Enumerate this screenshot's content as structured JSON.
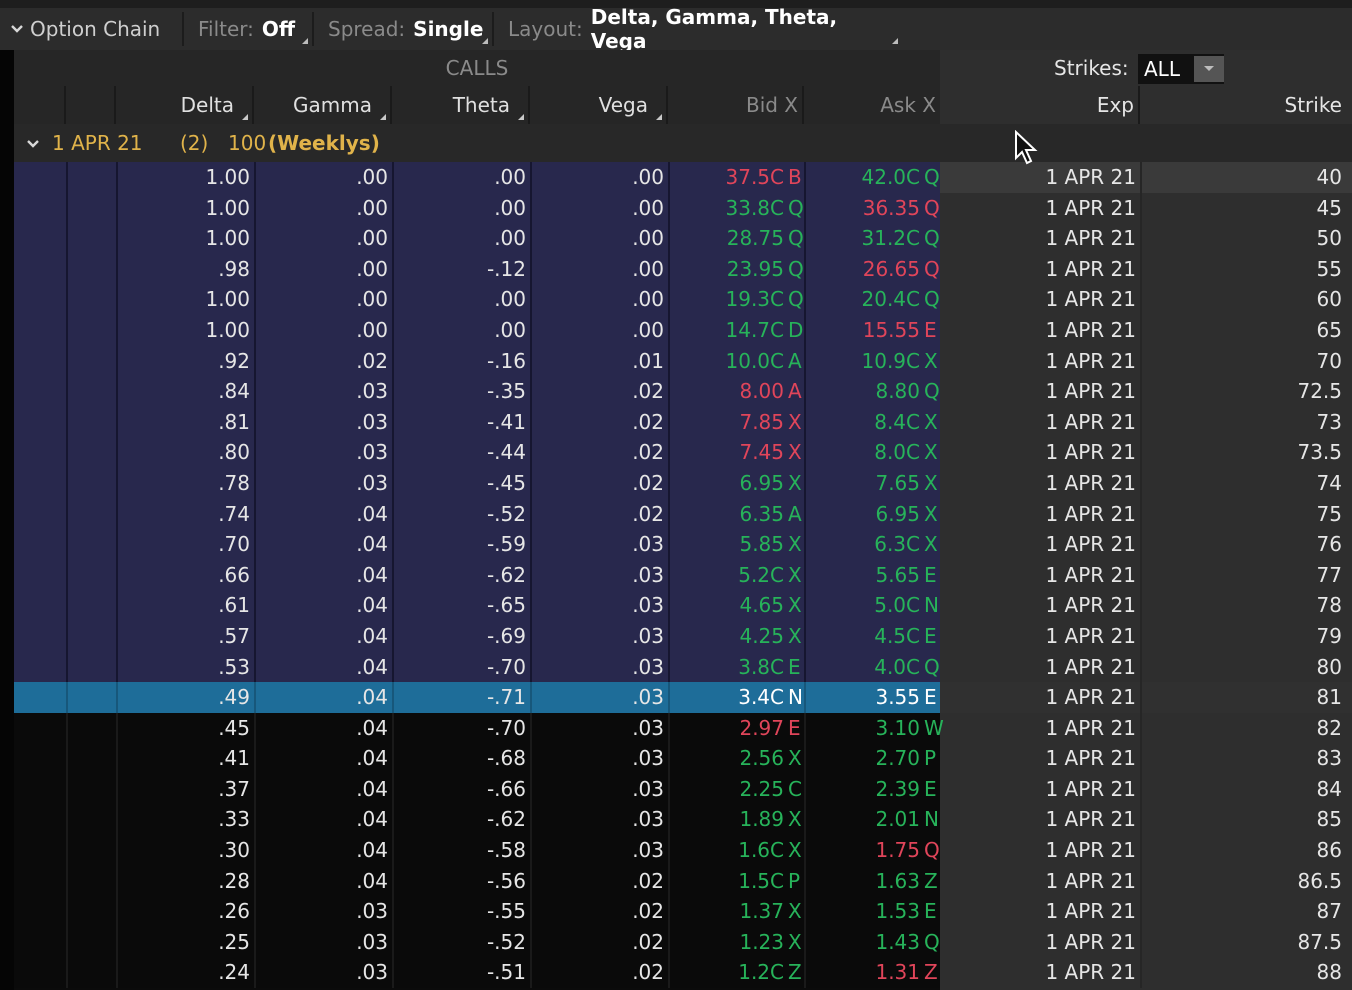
{
  "toolbar": {
    "title": "Option Chain",
    "filter_label": "Filter:",
    "filter_value": "Off",
    "spread_label": "Spread:",
    "spread_value": "Single",
    "layout_label": "Layout:",
    "layout_value": "Delta, Gamma, Theta, Vega"
  },
  "calls_header": "CALLS",
  "strikes": {
    "label": "Strikes:",
    "value": "ALL"
  },
  "columns": {
    "delta": "Delta",
    "gamma": "Gamma",
    "theta": "Theta",
    "vega": "Vega",
    "bid": "Bid X",
    "ask": "Ask X",
    "exp": "Exp",
    "strike": "Strike"
  },
  "group": {
    "label": "1 APR 21",
    "count": "(2)",
    "multiplier": "100",
    "tag": "(Weeklys)"
  },
  "colors": {
    "itm_bg": "#28284d",
    "selected_bg": "#1e6d99",
    "bid_ask_up": "#27b35a",
    "bid_ask_down": "#e0455a",
    "group_text": "#e0b34a"
  },
  "rows": [
    {
      "delta": "1.00",
      "gamma": ".00",
      "theta": ".00",
      "vega": ".00",
      "bid": "37.5C",
      "bid_ex": "B",
      "bid_color": "red",
      "ask": "42.0C",
      "ask_ex": "Q",
      "ask_color": "green",
      "exp": "1 APR 21",
      "strike": "40",
      "state": "itm"
    },
    {
      "delta": "1.00",
      "gamma": ".00",
      "theta": ".00",
      "vega": ".00",
      "bid": "33.8C",
      "bid_ex": "Q",
      "bid_color": "green",
      "ask": "36.35",
      "ask_ex": "Q",
      "ask_color": "red",
      "exp": "1 APR 21",
      "strike": "45",
      "state": "itm"
    },
    {
      "delta": "1.00",
      "gamma": ".00",
      "theta": ".00",
      "vega": ".00",
      "bid": "28.75",
      "bid_ex": "Q",
      "bid_color": "green",
      "ask": "31.2C",
      "ask_ex": "Q",
      "ask_color": "green",
      "exp": "1 APR 21",
      "strike": "50",
      "state": "itm"
    },
    {
      "delta": ".98",
      "gamma": ".00",
      "theta": "-.12",
      "vega": ".00",
      "bid": "23.95",
      "bid_ex": "Q",
      "bid_color": "green",
      "ask": "26.65",
      "ask_ex": "Q",
      "ask_color": "red",
      "exp": "1 APR 21",
      "strike": "55",
      "state": "itm"
    },
    {
      "delta": "1.00",
      "gamma": ".00",
      "theta": ".00",
      "vega": ".00",
      "bid": "19.3C",
      "bid_ex": "Q",
      "bid_color": "green",
      "ask": "20.4C",
      "ask_ex": "Q",
      "ask_color": "green",
      "exp": "1 APR 21",
      "strike": "60",
      "state": "itm"
    },
    {
      "delta": "1.00",
      "gamma": ".00",
      "theta": ".00",
      "vega": ".00",
      "bid": "14.7C",
      "bid_ex": "D",
      "bid_color": "green",
      "ask": "15.55",
      "ask_ex": "E",
      "ask_color": "red",
      "exp": "1 APR 21",
      "strike": "65",
      "state": "itm"
    },
    {
      "delta": ".92",
      "gamma": ".02",
      "theta": "-.16",
      "vega": ".01",
      "bid": "10.0C",
      "bid_ex": "A",
      "bid_color": "green",
      "ask": "10.9C",
      "ask_ex": "X",
      "ask_color": "green",
      "exp": "1 APR 21",
      "strike": "70",
      "state": "itm"
    },
    {
      "delta": ".84",
      "gamma": ".03",
      "theta": "-.35",
      "vega": ".02",
      "bid": "8.00",
      "bid_ex": "A",
      "bid_color": "red",
      "ask": "8.80",
      "ask_ex": "Q",
      "ask_color": "green",
      "exp": "1 APR 21",
      "strike": "72.5",
      "state": "itm"
    },
    {
      "delta": ".81",
      "gamma": ".03",
      "theta": "-.41",
      "vega": ".02",
      "bid": "7.85",
      "bid_ex": "X",
      "bid_color": "red",
      "ask": "8.4C",
      "ask_ex": "X",
      "ask_color": "green",
      "exp": "1 APR 21",
      "strike": "73",
      "state": "itm"
    },
    {
      "delta": ".80",
      "gamma": ".03",
      "theta": "-.44",
      "vega": ".02",
      "bid": "7.45",
      "bid_ex": "X",
      "bid_color": "red",
      "ask": "8.0C",
      "ask_ex": "X",
      "ask_color": "green",
      "exp": "1 APR 21",
      "strike": "73.5",
      "state": "itm"
    },
    {
      "delta": ".78",
      "gamma": ".03",
      "theta": "-.45",
      "vega": ".02",
      "bid": "6.95",
      "bid_ex": "X",
      "bid_color": "green",
      "ask": "7.65",
      "ask_ex": "X",
      "ask_color": "green",
      "exp": "1 APR 21",
      "strike": "74",
      "state": "itm"
    },
    {
      "delta": ".74",
      "gamma": ".04",
      "theta": "-.52",
      "vega": ".02",
      "bid": "6.35",
      "bid_ex": "A",
      "bid_color": "green",
      "ask": "6.95",
      "ask_ex": "X",
      "ask_color": "green",
      "exp": "1 APR 21",
      "strike": "75",
      "state": "itm"
    },
    {
      "delta": ".70",
      "gamma": ".04",
      "theta": "-.59",
      "vega": ".03",
      "bid": "5.85",
      "bid_ex": "X",
      "bid_color": "green",
      "ask": "6.3C",
      "ask_ex": "X",
      "ask_color": "green",
      "exp": "1 APR 21",
      "strike": "76",
      "state": "itm"
    },
    {
      "delta": ".66",
      "gamma": ".04",
      "theta": "-.62",
      "vega": ".03",
      "bid": "5.2C",
      "bid_ex": "X",
      "bid_color": "green",
      "ask": "5.65",
      "ask_ex": "E",
      "ask_color": "green",
      "exp": "1 APR 21",
      "strike": "77",
      "state": "itm"
    },
    {
      "delta": ".61",
      "gamma": ".04",
      "theta": "-.65",
      "vega": ".03",
      "bid": "4.65",
      "bid_ex": "X",
      "bid_color": "green",
      "ask": "5.0C",
      "ask_ex": "N",
      "ask_color": "green",
      "exp": "1 APR 21",
      "strike": "78",
      "state": "itm"
    },
    {
      "delta": ".57",
      "gamma": ".04",
      "theta": "-.69",
      "vega": ".03",
      "bid": "4.25",
      "bid_ex": "X",
      "bid_color": "green",
      "ask": "4.5C",
      "ask_ex": "E",
      "ask_color": "green",
      "exp": "1 APR 21",
      "strike": "79",
      "state": "itm"
    },
    {
      "delta": ".53",
      "gamma": ".04",
      "theta": "-.70",
      "vega": ".03",
      "bid": "3.8C",
      "bid_ex": "E",
      "bid_color": "green",
      "ask": "4.0C",
      "ask_ex": "Q",
      "ask_color": "green",
      "exp": "1 APR 21",
      "strike": "80",
      "state": "itm"
    },
    {
      "delta": ".49",
      "gamma": ".04",
      "theta": "-.71",
      "vega": ".03",
      "bid": "3.4C",
      "bid_ex": "N",
      "bid_color": "white",
      "ask": "3.55",
      "ask_ex": "E",
      "ask_color": "white",
      "exp": "1 APR 21",
      "strike": "81",
      "state": "sel"
    },
    {
      "delta": ".45",
      "gamma": ".04",
      "theta": "-.70",
      "vega": ".03",
      "bid": "2.97",
      "bid_ex": "E",
      "bid_color": "red",
      "ask": "3.10",
      "ask_ex": "W",
      "ask_color": "green",
      "exp": "1 APR 21",
      "strike": "82",
      "state": "otm"
    },
    {
      "delta": ".41",
      "gamma": ".04",
      "theta": "-.68",
      "vega": ".03",
      "bid": "2.56",
      "bid_ex": "X",
      "bid_color": "green",
      "ask": "2.70",
      "ask_ex": "P",
      "ask_color": "green",
      "exp": "1 APR 21",
      "strike": "83",
      "state": "otm"
    },
    {
      "delta": ".37",
      "gamma": ".04",
      "theta": "-.66",
      "vega": ".03",
      "bid": "2.25",
      "bid_ex": "C",
      "bid_color": "green",
      "ask": "2.39",
      "ask_ex": "E",
      "ask_color": "green",
      "exp": "1 APR 21",
      "strike": "84",
      "state": "otm"
    },
    {
      "delta": ".33",
      "gamma": ".04",
      "theta": "-.62",
      "vega": ".03",
      "bid": "1.89",
      "bid_ex": "X",
      "bid_color": "green",
      "ask": "2.01",
      "ask_ex": "N",
      "ask_color": "green",
      "exp": "1 APR 21",
      "strike": "85",
      "state": "otm"
    },
    {
      "delta": ".30",
      "gamma": ".04",
      "theta": "-.58",
      "vega": ".03",
      "bid": "1.6C",
      "bid_ex": "X",
      "bid_color": "green",
      "ask": "1.75",
      "ask_ex": "Q",
      "ask_color": "red",
      "exp": "1 APR 21",
      "strike": "86",
      "state": "otm"
    },
    {
      "delta": ".28",
      "gamma": ".04",
      "theta": "-.56",
      "vega": ".02",
      "bid": "1.5C",
      "bid_ex": "P",
      "bid_color": "green",
      "ask": "1.63",
      "ask_ex": "Z",
      "ask_color": "green",
      "exp": "1 APR 21",
      "strike": "86.5",
      "state": "otm"
    },
    {
      "delta": ".26",
      "gamma": ".03",
      "theta": "-.55",
      "vega": ".02",
      "bid": "1.37",
      "bid_ex": "X",
      "bid_color": "green",
      "ask": "1.53",
      "ask_ex": "E",
      "ask_color": "green",
      "exp": "1 APR 21",
      "strike": "87",
      "state": "otm"
    },
    {
      "delta": ".25",
      "gamma": ".03",
      "theta": "-.52",
      "vega": ".02",
      "bid": "1.23",
      "bid_ex": "X",
      "bid_color": "green",
      "ask": "1.43",
      "ask_ex": "Q",
      "ask_color": "green",
      "exp": "1 APR 21",
      "strike": "87.5",
      "state": "otm"
    },
    {
      "delta": ".24",
      "gamma": ".03",
      "theta": "-.51",
      "vega": ".02",
      "bid": "1.2C",
      "bid_ex": "Z",
      "bid_color": "green",
      "ask": "1.31",
      "ask_ex": "Z",
      "ask_color": "red",
      "exp": "1 APR 21",
      "strike": "88",
      "state": "otm"
    }
  ]
}
